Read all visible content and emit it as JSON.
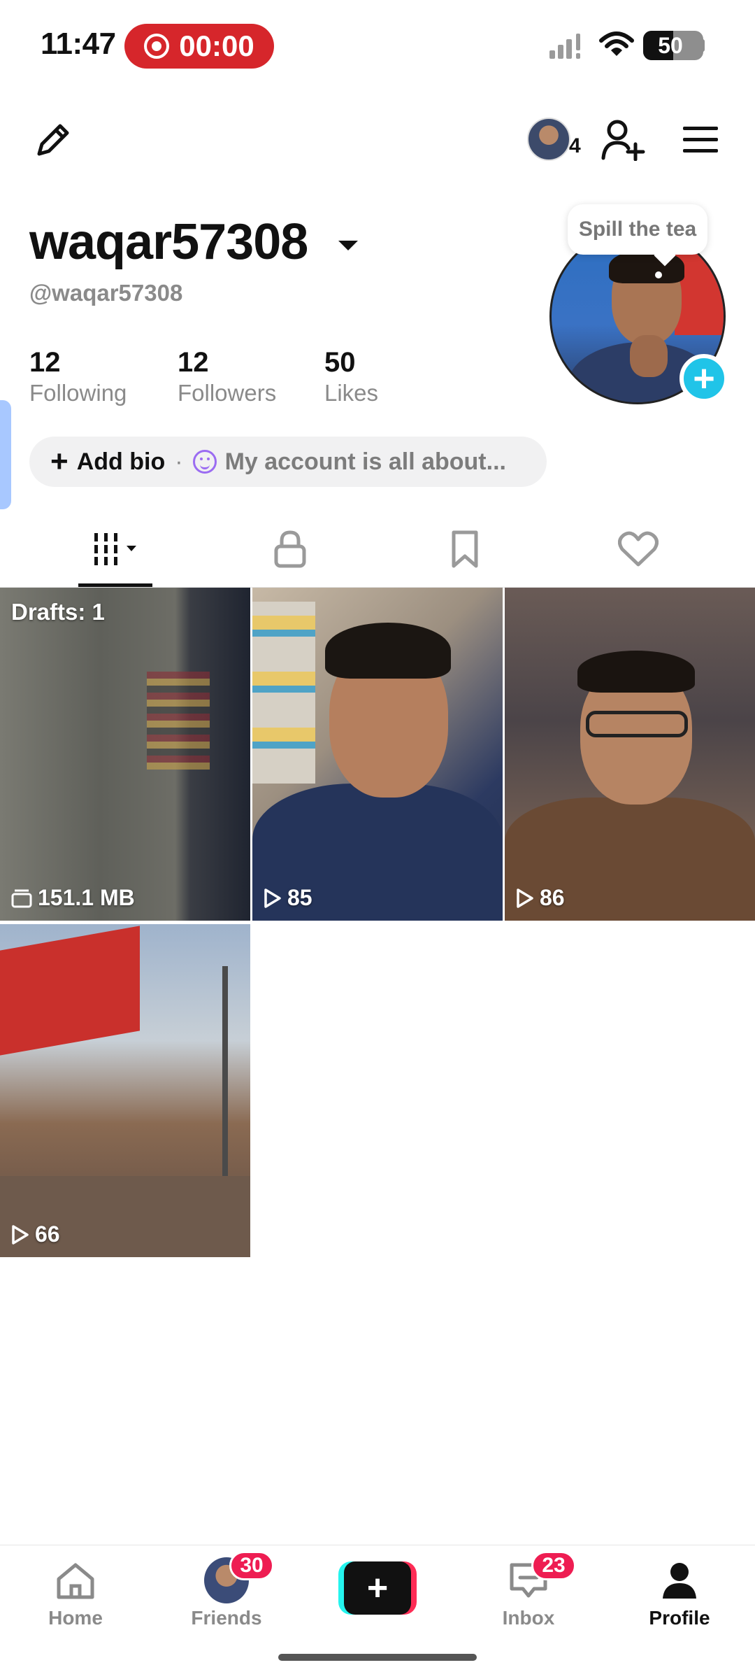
{
  "status_bar": {
    "time": "11:47",
    "recording_timer": "00:00",
    "battery": "50"
  },
  "header": {
    "story_count": "4"
  },
  "profile": {
    "username": "waqar57308",
    "handle": "@waqar57308",
    "stats": [
      {
        "value": "12",
        "label": "Following"
      },
      {
        "value": "12",
        "label": "Followers"
      },
      {
        "value": "50",
        "label": "Likes"
      }
    ],
    "note_bubble": "Spill the tea",
    "add_bio_label": "Add bio",
    "bio_separator": "·",
    "bio_hint": "My account is all about..."
  },
  "tabs": [
    {
      "icon": "grid-icon",
      "active": true
    },
    {
      "icon": "lock-icon"
    },
    {
      "icon": "bookmark-icon"
    },
    {
      "icon": "heart-icon"
    }
  ],
  "grid": {
    "drafts_label": "Drafts: 1",
    "items": [
      {
        "stat": "151.1 MB",
        "icon": "drafts-icon"
      },
      {
        "stat": "85",
        "icon": "play-icon"
      },
      {
        "stat": "86",
        "icon": "play-icon"
      },
      {
        "stat": "66",
        "icon": "play-icon"
      }
    ]
  },
  "bottom_nav": {
    "items": [
      {
        "label": "Home"
      },
      {
        "label": "Friends",
        "badge": "30"
      },
      {
        "label": "Inbox",
        "badge": "23"
      },
      {
        "label": "Profile"
      }
    ]
  },
  "colors": {
    "record_red": "#d6262b",
    "accent_cyan": "#20c4e8",
    "badge_red": "#ee1d52"
  }
}
